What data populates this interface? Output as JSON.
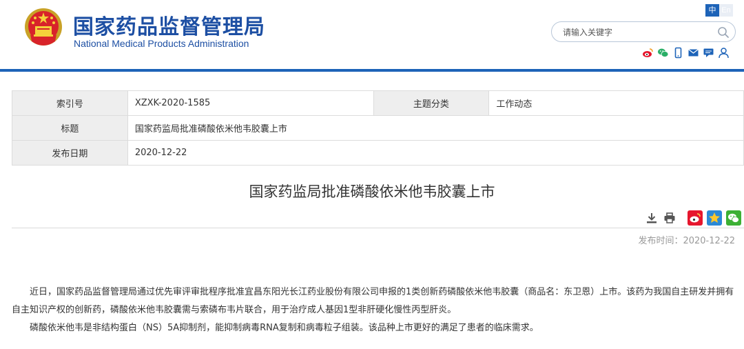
{
  "header": {
    "title_cn": "国家药品监督管理局",
    "title_en": "National Medical Products Administration",
    "lang": {
      "zh": "中",
      "en": "En"
    },
    "search": {
      "placeholder": "请输入关键字"
    },
    "social_icons": [
      "weibo-icon",
      "wechat-icon",
      "mobile-icon",
      "mail-icon",
      "message-icon",
      "user-icon"
    ]
  },
  "info_table": {
    "index_label": "索引号",
    "index_value": "XZXK-2020-1585",
    "category_label": "主题分类",
    "category_value": "工作动态",
    "title_label": "标题",
    "title_value": "国家药监局批准磷酸依米他韦胶囊上市",
    "date_label": "发布日期",
    "date_value": "2020-12-22"
  },
  "article": {
    "title": "国家药监局批准磷酸依米他韦胶囊上市",
    "publish_time": "发布时间：2020-12-22",
    "tools": [
      "download-icon",
      "print-icon",
      "share-weibo-icon",
      "share-qzone-icon",
      "share-wechat-icon"
    ],
    "paragraphs": [
      "近日，国家药品监督管理局通过优先审评审批程序批准宜昌东阳光长江药业股份有限公司申报的1类创新药磷酸依米他韦胶囊（商品名：东卫恩）上市。该药为我国自主研发并拥有自主知识产权的创新药，磷酸依米他韦胶囊需与索磷布韦片联合，用于治疗成人基因1型非肝硬化慢性丙型肝炎。",
      "磷酸依米他韦是非结构蛋白（NS）5A抑制剂，能抑制病毒RNA复制和病毒粒子组装。该品种上市更好的满足了患者的临床需求。"
    ]
  },
  "colors": {
    "brand_blue": "#1d4fa3",
    "rule_blue": "#1d63b8",
    "icon_red": "#d9342b"
  }
}
